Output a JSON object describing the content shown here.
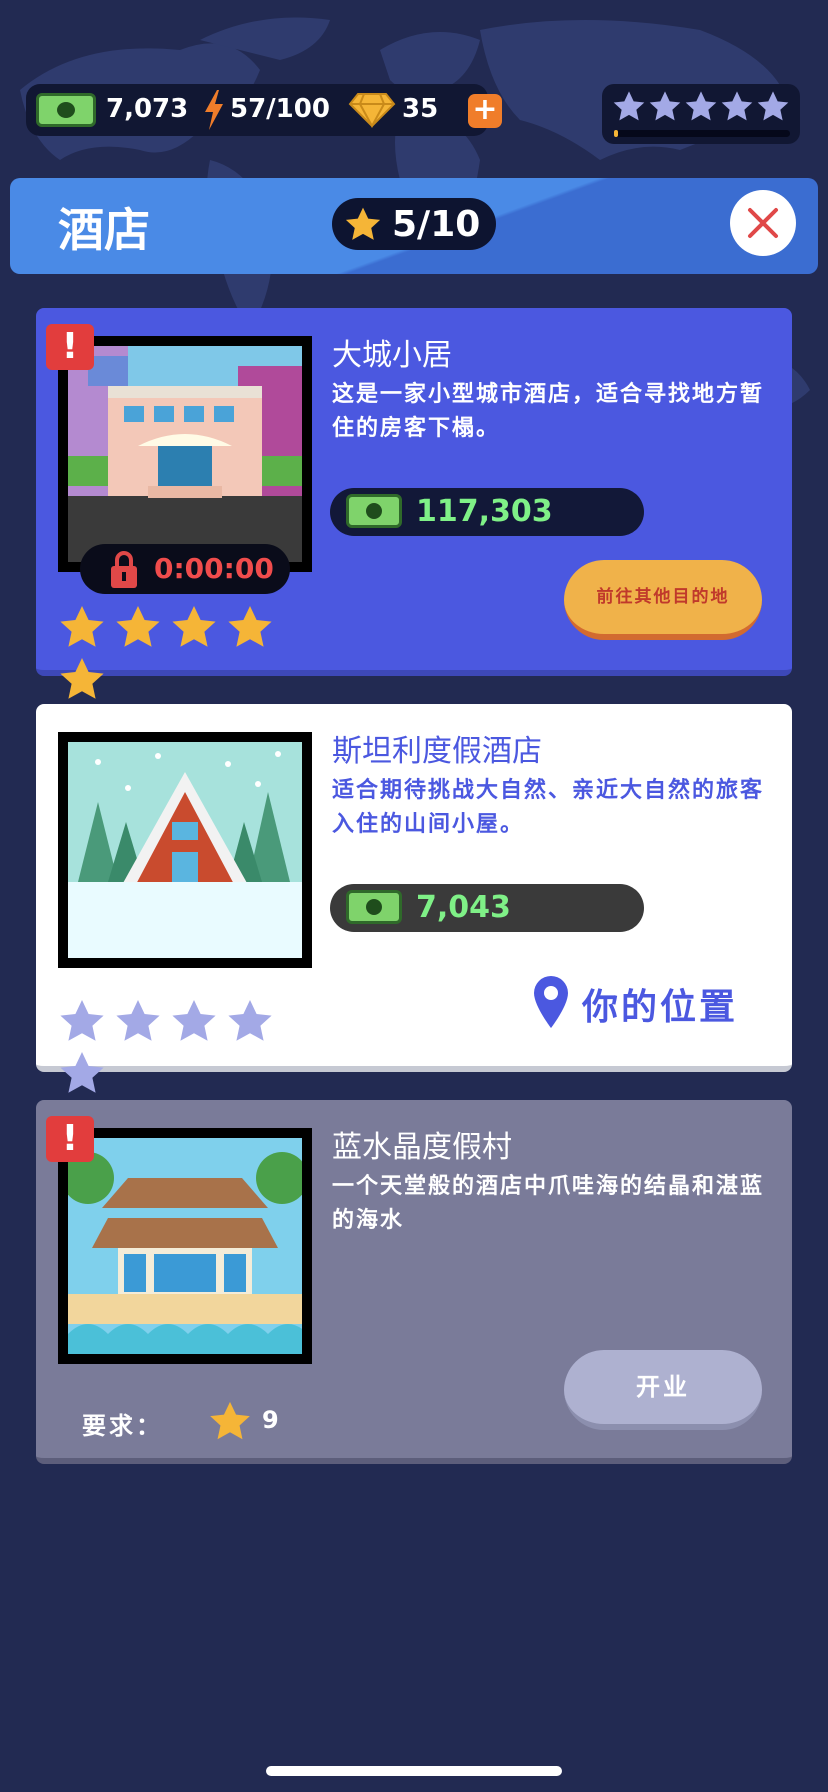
{
  "hud": {
    "cash": "7,073",
    "energy": "57/100",
    "gems": "35",
    "plus_label": "+",
    "rating_stars": 5,
    "rating_progress": 0.02
  },
  "header": {
    "title": "酒店",
    "star_progress": "5/10",
    "close_icon": "close-icon"
  },
  "hotels": [
    {
      "name": "大城小居",
      "description": "这是一家小型城市酒店，适合寻找地方暂住的房客下榻。",
      "price": "117,303",
      "timer": "0:00:00",
      "stars_filled": 5,
      "action_label": "前往其他目的地",
      "alert": "!"
    },
    {
      "name": "斯坦利度假酒店",
      "description": "适合期待挑战大自然、亲近大自然的旅客入住的山间小屋。",
      "price": "7,043",
      "stars_filled": 0,
      "location_label": "你的位置"
    },
    {
      "name": "蓝水晶度假村",
      "description": "一个天堂般的酒店中爪哇海的结晶和湛蓝的海水",
      "requirement_label": "要求：",
      "requirement_stars": "9",
      "action_label": "开业",
      "alert": "!"
    }
  ],
  "colors": {
    "background": "#222a52",
    "card_active": "#4b58e0",
    "card_current": "#ffffff",
    "card_locked": "#7a7b99",
    "star_gold": "#f5b537",
    "star_empty": "#a3a9e6",
    "accent_orange": "#f0b24a"
  }
}
